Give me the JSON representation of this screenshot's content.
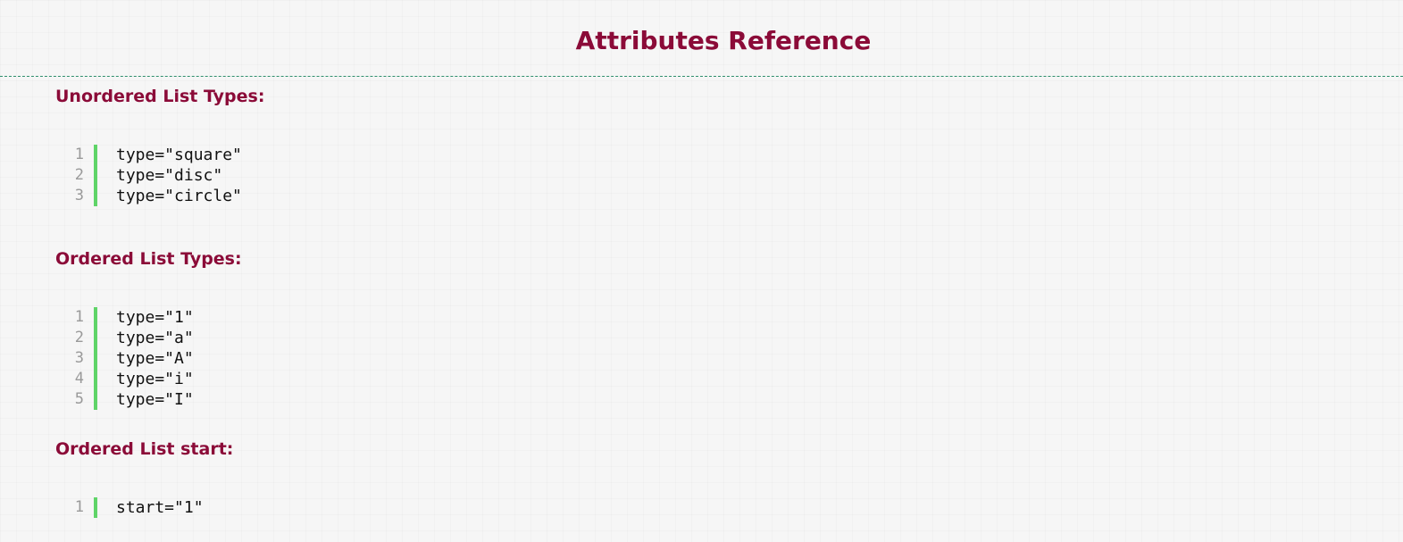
{
  "header": {
    "title": "Attributes Reference"
  },
  "sections": [
    {
      "heading": "Unordered List Types:",
      "lines": [
        {
          "num": "1",
          "code": "type=\"square\""
        },
        {
          "num": "2",
          "code": "type=\"disc\""
        },
        {
          "num": "3",
          "code": "type=\"circle\""
        }
      ]
    },
    {
      "heading": "Ordered List Types:",
      "lines": [
        {
          "num": "1",
          "code": "type=\"1\""
        },
        {
          "num": "2",
          "code": "type=\"a\""
        },
        {
          "num": "3",
          "code": "type=\"A\""
        },
        {
          "num": "4",
          "code": "type=\"i\""
        },
        {
          "num": "5",
          "code": "type=\"I\""
        }
      ]
    },
    {
      "heading": "Ordered List start:",
      "lines": [
        {
          "num": "1",
          "code": "start=\"1\""
        }
      ]
    }
  ],
  "colors": {
    "heading": "#8b0b38",
    "gutter_bar": "#5fd468",
    "line_number": "#9a9a9a",
    "divider": "#2f8f6c"
  }
}
